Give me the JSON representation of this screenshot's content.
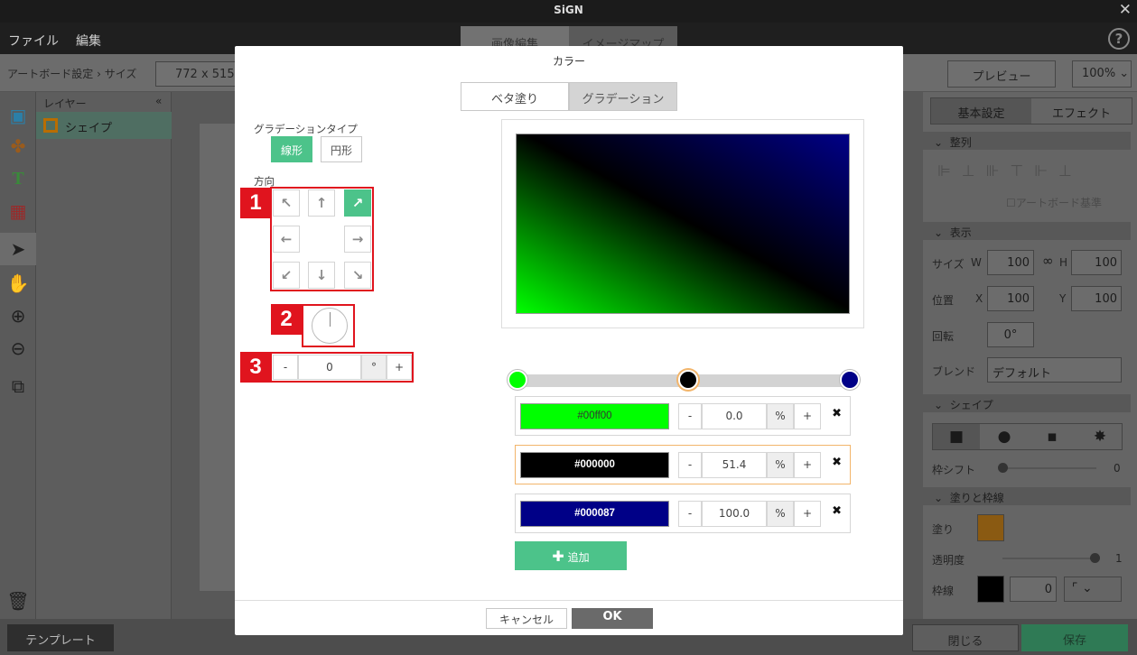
{
  "app": {
    "title": "SiGN"
  },
  "menu": {
    "file": "ファイル",
    "edit": "編集"
  },
  "mode_tabs": [
    "画像編集",
    "イメージマップ"
  ],
  "toolbar": {
    "breadcrumb": "アートボード設定 › サイズ",
    "size_value": "772 x 515",
    "preview_label": "プレビュー",
    "zoom": "100%"
  },
  "layers": {
    "header": "レイヤー",
    "collapse": "«",
    "item": "シェイプ"
  },
  "right_panel": {
    "tabs": [
      "基本設定",
      "エフェクト"
    ],
    "sections": {
      "align": "整列",
      "display": "表示",
      "shape": "シェイプ",
      "fill_stroke": "塗りと枠線"
    },
    "artboard_ref": "アートボード基準",
    "size_label": "サイズ",
    "w_label": "W",
    "w_value": "100",
    "h_label": "H",
    "h_value": "100",
    "pos_label": "位置",
    "x_label": "X",
    "x_value": "100",
    "y_label": "Y",
    "y_value": "100",
    "rotate_label": "回転",
    "rotate_value": "0°",
    "blend_label": "ブレンド",
    "blend_value": "デフォルト",
    "frame_shift_label": "枠シフト",
    "frame_shift_value": "0",
    "fill_label": "塗り",
    "fill_color": "#d98a00",
    "opacity_label": "透明度",
    "opacity_value": "1",
    "stroke_label": "枠線",
    "stroke_value": "0"
  },
  "bottom": {
    "template": "テンプレート",
    "close": "閉じる",
    "save": "保存"
  },
  "modal": {
    "title": "カラー",
    "fill_tabs": {
      "solid": "ベタ塗り",
      "gradient": "グラデーション"
    },
    "gradient_type_label": "グラデーションタイプ",
    "type_linear": "線形",
    "type_radial": "円形",
    "direction_label": "方向",
    "callouts": [
      "1",
      "2",
      "3"
    ],
    "angle": {
      "minus": "-",
      "value": "0",
      "unit": "°",
      "plus": "+"
    },
    "stops": [
      {
        "color": "#00ff00",
        "label": "#00ff00",
        "position": "0.0",
        "pos_frac": 0.0
      },
      {
        "color": "#000000",
        "label": "#000000",
        "position": "51.4",
        "pos_frac": 0.514
      },
      {
        "color": "#000087",
        "label": "#000087",
        "position": "100.0",
        "pos_frac": 1.0
      }
    ],
    "stop_controls": {
      "minus": "-",
      "percent": "%",
      "plus": "+",
      "delete": "✖"
    },
    "add_label": "追加",
    "cancel": "キャンセル",
    "ok": "OK"
  }
}
